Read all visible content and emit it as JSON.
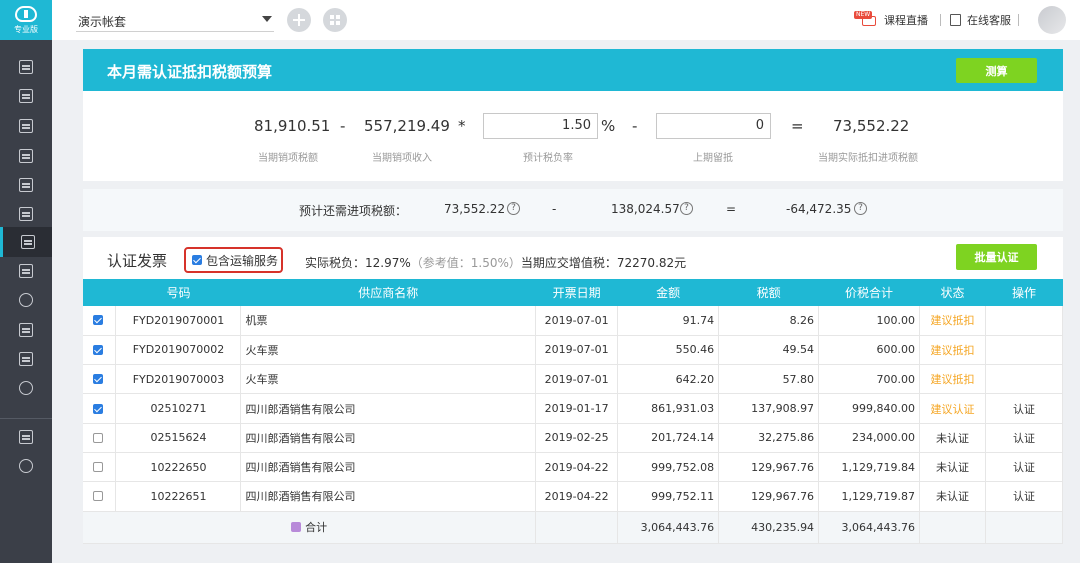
{
  "sidebar": {
    "logo_label": "专业版",
    "items": [
      "list-icon",
      "invoice-icon",
      "chart-icon",
      "building-icon",
      "calculator-icon",
      "receipt-icon",
      "tax-icon",
      "image-icon",
      "stamp-icon",
      "export-icon",
      "shield-icon",
      "gear-icon"
    ],
    "bottom_items": [
      "play-icon",
      "speed-icon"
    ]
  },
  "topbar": {
    "account_name": "演示帐套",
    "live_badge": "NEW",
    "live_label": "课程直播",
    "service_label": "在线客服"
  },
  "budget": {
    "title": "本月需认证抵扣税额预算",
    "calc_button": "测算",
    "output_tax": "81,910.51",
    "output_tax_label": "当期销项税额",
    "op_minus1": "-",
    "sales_income": "557,219.49",
    "sales_income_label": "当期销项收入",
    "op_times": "*",
    "tax_rate": "1.50",
    "tax_rate_label": "预计税负率",
    "percent": "%",
    "op_minus2": "-",
    "retained": "0",
    "retained_label": "上期留抵",
    "op_equals": "=",
    "result": "73,552.22",
    "result_label": "当期实际抵扣进项税额",
    "estimate_label": "预计还需进项税额：",
    "estimate_a": "73,552.22",
    "estimate_minus": "-",
    "estimate_b": "138,024.57",
    "estimate_equals": "=",
    "estimate_result": "-64,472.35",
    "q_mark": "?"
  },
  "invoices": {
    "title": "认证发票",
    "include_transport": "包含运输服务",
    "actual_tax_label": "实际税负：12.97%",
    "reference": "（参考值：1.50%）",
    "vat_payable": "当期应交增值税：72270.82元",
    "batch_button": "批量认证",
    "columns": [
      "号码",
      "供应商名称",
      "开票日期",
      "金额",
      "税额",
      "价税合计",
      "状态",
      "操作"
    ],
    "rows": [
      {
        "checked": true,
        "number": "FYD2019070001",
        "supplier": "机票",
        "date": "2019-07-01",
        "amount": "91.74",
        "tax": "8.26",
        "total": "100.00",
        "status": "建议抵扣",
        "status_color": "#f5a623",
        "action": ""
      },
      {
        "checked": true,
        "number": "FYD2019070002",
        "supplier": "火车票",
        "date": "2019-07-01",
        "amount": "550.46",
        "tax": "49.54",
        "total": "600.00",
        "status": "建议抵扣",
        "status_color": "#f5a623",
        "action": ""
      },
      {
        "checked": true,
        "number": "FYD2019070003",
        "supplier": "火车票",
        "date": "2019-07-01",
        "amount": "642.20",
        "tax": "57.80",
        "total": "700.00",
        "status": "建议抵扣",
        "status_color": "#f5a623",
        "action": ""
      },
      {
        "checked": true,
        "number": "02510271",
        "supplier": "四川郎酒销售有限公司",
        "date": "2019-01-17",
        "amount": "861,931.03",
        "tax": "137,908.97",
        "total": "999,840.00",
        "status": "建议认证",
        "status_color": "#f5a623",
        "action": "认证"
      },
      {
        "checked": false,
        "number": "02515624",
        "supplier": "四川郎酒销售有限公司",
        "date": "2019-02-25",
        "amount": "201,724.14",
        "tax": "32,275.86",
        "total": "234,000.00",
        "status": "未认证",
        "status_color": "#333333",
        "action": "认证"
      },
      {
        "checked": false,
        "number": "10222650",
        "supplier": "四川郎酒销售有限公司",
        "date": "2019-04-22",
        "amount": "999,752.08",
        "tax": "129,967.76",
        "total": "1,129,719.84",
        "status": "未认证",
        "status_color": "#333333",
        "action": "认证"
      },
      {
        "checked": false,
        "number": "10222651",
        "supplier": "四川郎酒销售有限公司",
        "date": "2019-04-22",
        "amount": "999,752.11",
        "tax": "129,967.76",
        "total": "1,129,719.87",
        "status": "未认证",
        "status_color": "#333333",
        "action": "认证"
      }
    ],
    "total_label": "合计",
    "total_amount": "3,064,443.76",
    "total_tax": "430,235.94",
    "total_sum": "3,064,443.76"
  },
  "colors": {
    "accent": "#1fb8d4",
    "green": "#7ed321",
    "warning": "#f5a623",
    "highlight": "#d6332a",
    "sidebar": "#3b3f48"
  }
}
